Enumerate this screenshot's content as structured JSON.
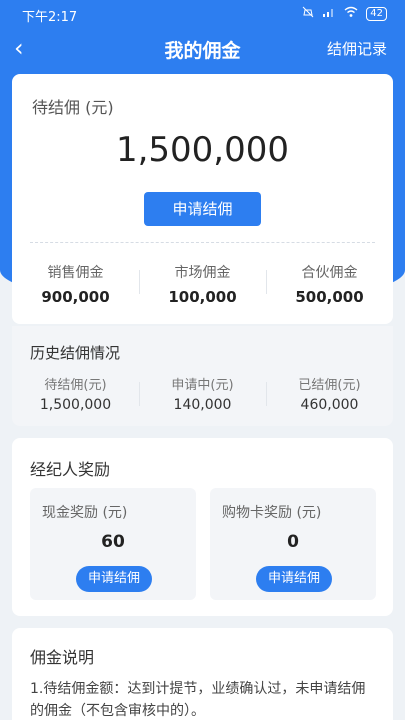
{
  "status_bar": {
    "time": "下午2:17",
    "battery": "42"
  },
  "nav": {
    "back_icon": "‹",
    "title": "我的佣金",
    "record": "结佣记录"
  },
  "pending": {
    "label": "待结佣 (元)",
    "amount": "1,500,000",
    "button": "申请结佣",
    "stats": [
      {
        "label": "销售佣金",
        "value": "900,000"
      },
      {
        "label": "市场佣金",
        "value": "100,000"
      },
      {
        "label": "合伙佣金",
        "value": "500,000"
      }
    ]
  },
  "history": {
    "title": "历史结佣情况",
    "stats": [
      {
        "label": "待结佣(元)",
        "value": "1,500,000"
      },
      {
        "label": "申请中(元)",
        "value": "140,000"
      },
      {
        "label": "已结佣(元)",
        "value": "460,000"
      }
    ]
  },
  "rewards": {
    "title": "经纪人奖励",
    "items": [
      {
        "label": "现金奖励 (元)",
        "value": "60",
        "button": "申请结佣"
      },
      {
        "label": "购物卡奖励 (元)",
        "value": "0",
        "button": "申请结佣"
      }
    ]
  },
  "explain": {
    "title": "佣金说明",
    "text": "1.待结佣金额：达到计提节，业绩确认过，未申请结佣的佣金（不包含审核中的）。"
  }
}
